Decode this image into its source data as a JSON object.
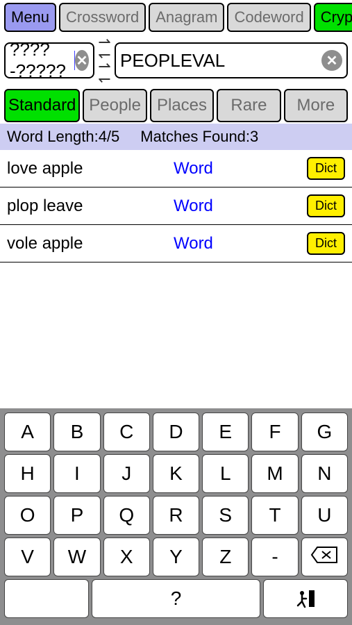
{
  "topbar": {
    "menu": "Menu",
    "crossword": "Crossword",
    "anagram": "Anagram",
    "codeword": "Codeword",
    "cryptic": "Cryptic"
  },
  "inputs": {
    "left_value": "????-?????",
    "right_value": "PEOPLEVAL"
  },
  "filters": {
    "standard": "Standard",
    "people": "People",
    "places": "Places",
    "rare": "Rare",
    "more": "More"
  },
  "status": {
    "wl_label": "Word Length:",
    "wl_value": "4/5",
    "mf_label": "Matches Found:",
    "mf_value": "3"
  },
  "results": [
    {
      "word": "love apple",
      "link": "Word",
      "dict": "Dict"
    },
    {
      "word": "plop leave",
      "link": "Word",
      "dict": "Dict"
    },
    {
      "word": "vole apple",
      "link": "Word",
      "dict": "Dict"
    }
  ],
  "keys": {
    "r1": [
      "A",
      "B",
      "C",
      "D",
      "E",
      "F",
      "G"
    ],
    "r2": [
      "H",
      "I",
      "J",
      "K",
      "L",
      "M",
      "N"
    ],
    "r3": [
      "O",
      "P",
      "Q",
      "R",
      "S",
      "T",
      "U"
    ],
    "r4": [
      "V",
      "W",
      "X",
      "Y",
      "Z",
      "-"
    ],
    "question": "?"
  }
}
